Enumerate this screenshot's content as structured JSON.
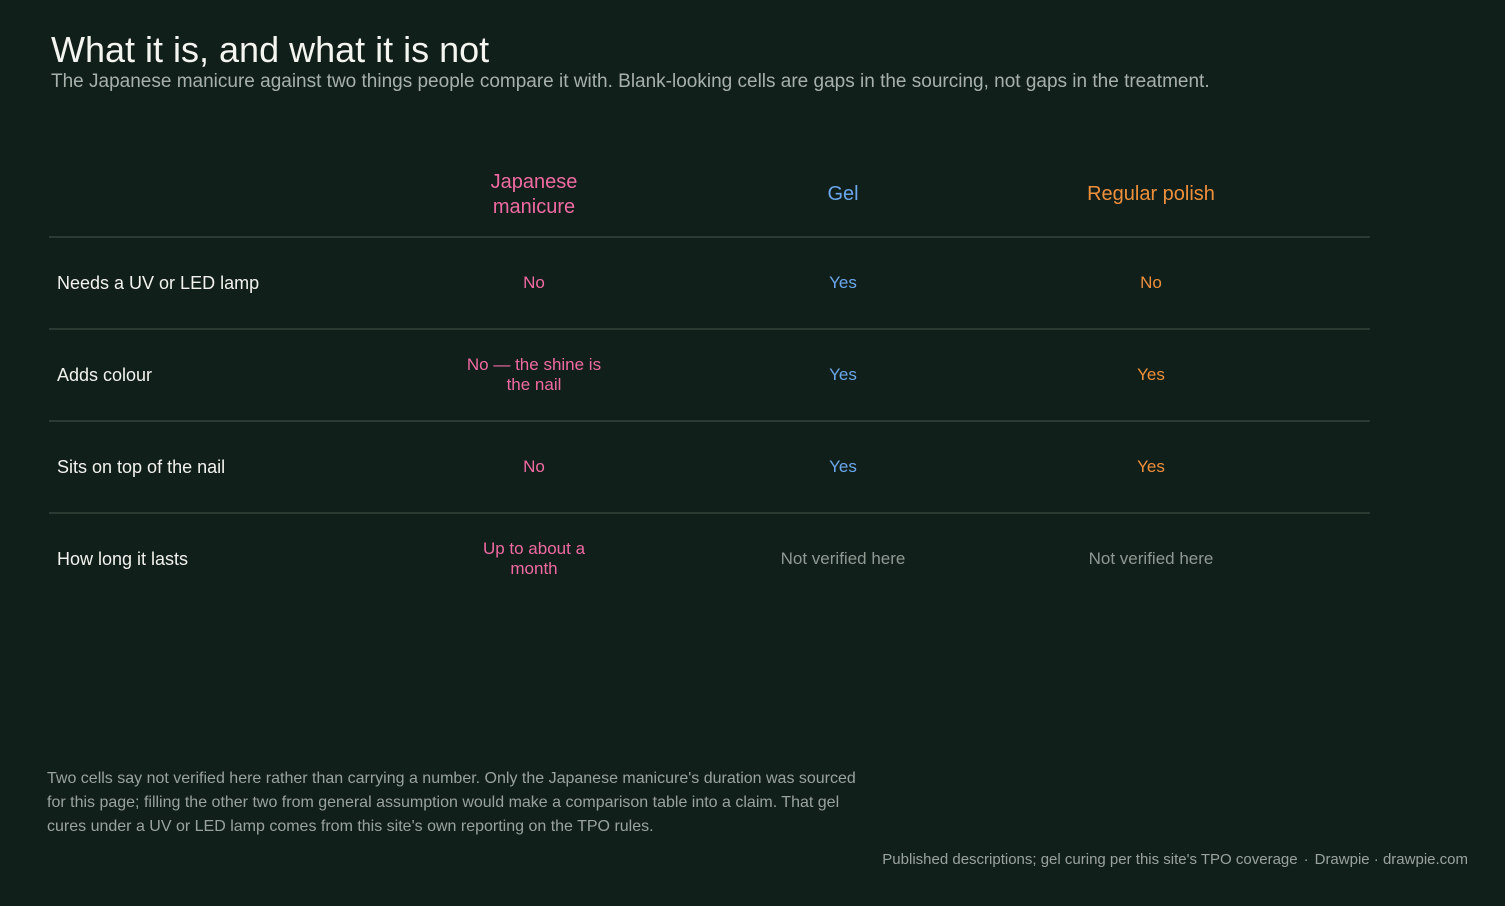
{
  "title": "What it is, and what it is not",
  "subtitle": "The Japanese manicure against two things people compare it with. Blank-looking cells are gaps in the sourcing, not gaps in the treatment.",
  "chart_data": {
    "type": "table",
    "columns": [
      {
        "label": "Japanese manicure",
        "color": "#f06aa2"
      },
      {
        "label": "Gel",
        "color": "#6aa6ec"
      },
      {
        "label": "Regular polish",
        "color": "#ee8f3c"
      }
    ],
    "rows": [
      {
        "label": "Needs a UV or LED lamp",
        "cells": [
          "No",
          "Yes",
          "No"
        ]
      },
      {
        "label": "Adds colour",
        "cells": [
          "No — the shine is the nail",
          "Yes",
          "Yes"
        ]
      },
      {
        "label": "Sits on top of the nail",
        "cells": [
          "No",
          "Yes",
          "Yes"
        ]
      },
      {
        "label": "How long it lasts",
        "cells": [
          "Up to about a month",
          "Not verified here",
          "Not verified here"
        ]
      }
    ],
    "muted_value_color": "#8f9993"
  },
  "note": "Two cells say not verified here rather than carrying a number. Only the Japanese manicure's duration was sourced for this page; filling the other two from general assumption would make a comparison table into a claim. That gel cures under a UV or LED lamp comes from this site's own reporting on the TPO rules.",
  "source": {
    "text": "Published descriptions; gel curing per this site's TPO coverage",
    "separator": "·",
    "credit": "Drawpie · drawpie.com"
  }
}
